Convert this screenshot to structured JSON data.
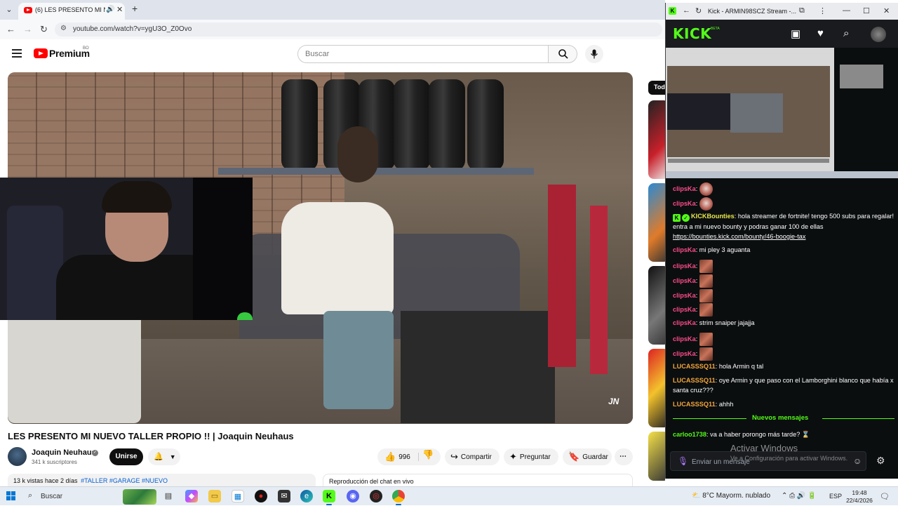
{
  "youtube_window": {
    "tab_title": "(6) LES PRESENTO MI NUEVO",
    "url": "youtube.com/watch?v=ygU3O_Z0Ovo",
    "logo_text": "Premium",
    "country": "BO",
    "search_placeholder": "Buscar",
    "video": {
      "title": "LES PRESENTO MI NUEVO TALLER PROPIO !! | Joaquin Neuhaus",
      "channel": "Joaquin Neuhaus",
      "subscribers": "341 k suscriptores",
      "join_label": "Unirse",
      "likes": "996",
      "share_label": "Compartir",
      "ask_label": "Preguntar",
      "save_label": "Guardar",
      "views_date": "13 k vistas  hace 2 días",
      "tags": "#TALLER #GARAGE #NUEVO",
      "chat_replay": "Reproducción del chat en vivo"
    },
    "chip_label": "Tod"
  },
  "kick_window": {
    "window_title": "Kick - ARMIN98SCZ Stream -...",
    "logo": "KICK",
    "logo_tag": "BETA",
    "chat": [
      {
        "user": "clipsKa",
        "user_color": "#ff4b8b",
        "text": "",
        "emote": "face"
      },
      {
        "user": "clipsKa",
        "user_color": "#ff4b8b",
        "text": "",
        "emote": "face"
      },
      {
        "user": "KICKBounties",
        "user_color": "#e8e84a",
        "text": "hola streamer de fortnite! tengo 500 subs para regalar! entra a mi nuevo bounty y podras ganar 100 de ellas",
        "link": "https://bounties.kick.com/bounty/46-boogie-tax"
      },
      {
        "user": "clipsKa",
        "user_color": "#ff4b8b",
        "text": "mi pley 3 aguanta"
      },
      {
        "user": "clipsKa",
        "user_color": "#ff4b8b",
        "text": "",
        "emote": "pic"
      },
      {
        "user": "clipsKa",
        "user_color": "#ff4b8b",
        "text": "",
        "emote": "pic"
      },
      {
        "user": "clipsKa",
        "user_color": "#ff4b8b",
        "text": "",
        "emote": "pic"
      },
      {
        "user": "clipsKa",
        "user_color": "#ff4b8b",
        "text": "",
        "emote": "pic"
      },
      {
        "user": "clipsKa",
        "user_color": "#ff4b8b",
        "text": "strim snaiper jajajja"
      },
      {
        "user": "clipsKa",
        "user_color": "#ff4b8b",
        "text": "",
        "emote": "pic"
      },
      {
        "user": "clipsKa",
        "user_color": "#ff4b8b",
        "text": "",
        "emote": "pic"
      },
      {
        "user": "LUCASSSQ11",
        "user_color": "#f2a53b",
        "text": "hola Armin q tal"
      },
      {
        "user": "LUCASSSQ11",
        "user_color": "#f2a53b",
        "text": "oye Armin y que paso con el Lamborghini blanco que había x santa cruz???"
      },
      {
        "user": "LUCASSSQ11",
        "user_color": "#f2a53b",
        "text": "ahhh"
      },
      {
        "user": "carloo1738",
        "user_color": "#53fc18",
        "text": "va a haber porongo más tarde?"
      }
    ],
    "new_messages_label": "Nuevos mensajes",
    "input_placeholder": "Enviar un mensaje"
  },
  "windows_overlay": {
    "activate_title": "Activar Windows",
    "activate_sub": "Ve a Configuración para activar Windows."
  },
  "taskbar": {
    "search_label": "Buscar",
    "weather": "8°C  Mayorm. nublado",
    "language": "ESP",
    "time": "19:48",
    "date": "22/4/2026"
  }
}
